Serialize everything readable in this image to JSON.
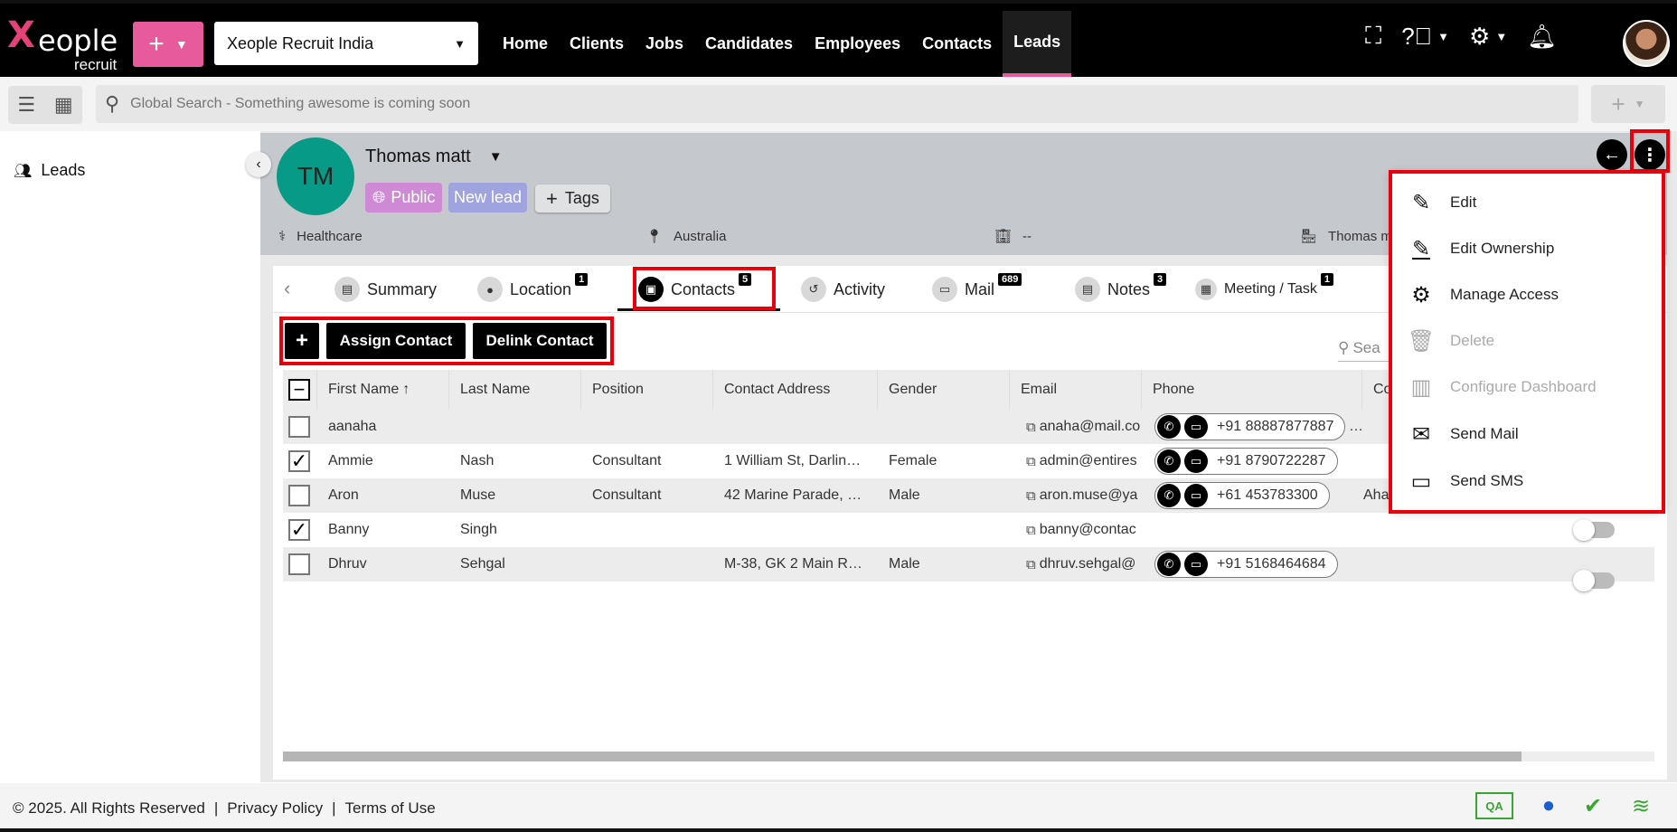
{
  "brand": {
    "logo_first": "X",
    "logo_rest": "eople",
    "logo_sub": "recruit"
  },
  "topbar": {
    "company": "Xeople Recruit India",
    "nav": [
      "Home",
      "Clients",
      "Jobs",
      "Candidates",
      "Employees",
      "Contacts",
      "Leads"
    ],
    "active_nav": "Leads"
  },
  "search": {
    "placeholder": "Global Search - Something awesome is coming soon"
  },
  "sidebar": {
    "items": [
      {
        "label": "Leads"
      }
    ]
  },
  "lead": {
    "initials": "TM",
    "name": "Thomas matt",
    "visibility": "Public",
    "status": "New lead",
    "tags_label": "Tags",
    "industry": "Healthcare",
    "country": "Australia",
    "company": "--",
    "owner": "Thomas m"
  },
  "tabs": [
    {
      "label": "Summary",
      "badge": ""
    },
    {
      "label": "Location",
      "badge": "1"
    },
    {
      "label": "Contacts",
      "badge": "5"
    },
    {
      "label": "Activity",
      "badge": ""
    },
    {
      "label": "Mail",
      "badge": "689"
    },
    {
      "label": "Notes",
      "badge": "3"
    },
    {
      "label": "Meeting / Task",
      "badge": "1"
    }
  ],
  "actions": {
    "add": "+",
    "assign": "Assign Contact",
    "delink": "Delink Contact",
    "search_placeholder": "Sea"
  },
  "table": {
    "headers": [
      "First Name",
      "Last Name",
      "Position",
      "Contact Address",
      "Gender",
      "Email",
      "Phone",
      "Co"
    ],
    "sort_indicator": "↑",
    "rows": [
      {
        "checked": false,
        "first": "aanaha",
        "last": "",
        "position": "",
        "address": "",
        "gender": "",
        "email": "anaha@mail.co",
        "phone": "+91 88887877887",
        "extra": "…",
        "toggle": false
      },
      {
        "checked": true,
        "first": "Ammie",
        "last": "Nash",
        "position": "Consultant",
        "address": "1 William St, Darlin…",
        "gender": "Female",
        "email": "admin@entires",
        "phone": "+91 8790722287",
        "extra": "",
        "toggle": false
      },
      {
        "checked": false,
        "first": "Aron",
        "last": "Muse",
        "position": "Consultant",
        "address": "42 Marine Parade, …",
        "gender": "Male",
        "email": "aron.muse@ya",
        "phone": "+61 453783300",
        "extra": "Aha",
        "toggle": false
      },
      {
        "checked": true,
        "first": "Banny",
        "last": "Singh",
        "position": "",
        "address": "",
        "gender": "",
        "email": "banny@contac",
        "phone": "",
        "extra": "",
        "toggle": true
      },
      {
        "checked": false,
        "first": "Dhruv",
        "last": "Sehgal",
        "position": "",
        "address": "M-38, GK 2 Main R…",
        "gender": "Male",
        "email": "dhruv.sehgal@",
        "phone": "+91 5168464684",
        "extra": "",
        "toggle": true
      }
    ]
  },
  "menu": {
    "items": [
      {
        "label": "Edit",
        "icon": "pencil-icon",
        "disabled": false
      },
      {
        "label": "Edit Ownership",
        "icon": "pencil-underline-icon",
        "disabled": false
      },
      {
        "label": "Manage Access",
        "icon": "gear-icon",
        "disabled": false
      },
      {
        "label": "Delete",
        "icon": "trash-icon",
        "disabled": true
      },
      {
        "label": "Configure Dashboard",
        "icon": "dashboard-icon",
        "disabled": true
      },
      {
        "label": "Send Mail",
        "icon": "mail-icon",
        "disabled": false
      },
      {
        "label": "Send SMS",
        "icon": "sms-icon",
        "disabled": false
      }
    ]
  },
  "footer": {
    "copyright": "© 2025. All Rights Reserved",
    "privacy": "Privacy Policy",
    "terms": "Terms of Use",
    "env": "QA"
  },
  "colors": {
    "accent_pink": "#e75a9c",
    "avatar_teal": "#079a86",
    "highlight_red": "#e8000d"
  }
}
